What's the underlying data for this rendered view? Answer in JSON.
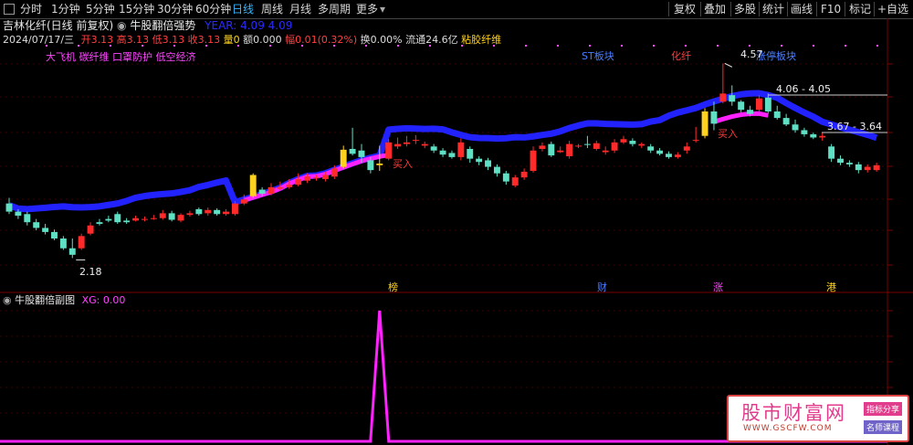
{
  "toolbar": {
    "left_buttons": [
      "分时",
      "1分钟",
      "5分钟",
      "15分钟",
      "30分钟",
      "60分钟",
      "日线",
      "周线",
      "月线",
      "多周期",
      "更多"
    ],
    "active": "日线",
    "right_buttons": [
      "复权",
      "叠加",
      "多股",
      "统计",
      "画线",
      "F10",
      "标记",
      "+自选"
    ]
  },
  "title": {
    "stock": "吉林化纤(日线 前复权)",
    "indicator": "牛股翻倍强势",
    "indicator_values": "YEAR: 4.09  4.09"
  },
  "info": {
    "date": "2024/07/17/三",
    "open": "开3.13",
    "high": "高3.13",
    "low": "低3.13",
    "close": "收3.13",
    "volume": "量0",
    "amount": "额0.000",
    "change": "幅0.01(0.32%)",
    "turnover": "换0.00%",
    "float": "流通24.6亿",
    "concept": "粘胶纤维"
  },
  "concept_tags": "大飞机 碳纤维 口罩防护 低空经济",
  "block_labels": {
    "st": "ST板块",
    "chem": "化纤",
    "limit": "涨停板块"
  },
  "price_labels": {
    "high": "4.57",
    "low": "2.18",
    "range1": "4.06 - 4.05",
    "range2": "3.67 - 3.64"
  },
  "buy_labels": [
    "买入",
    "买入"
  ],
  "bottom_markers": [
    "榜",
    "财",
    "涨",
    "港"
  ],
  "subchart": {
    "title": "牛股翻倍副图",
    "value": "XG: 0.00"
  },
  "watermark": {
    "logo": "股市财富网",
    "url": "WWW.GSCFW.COM",
    "tag1": "指标分享",
    "tag2": "名师课程"
  },
  "colors": {
    "up": "#ff2a2a",
    "down": "#5fe0c4",
    "blue_line": "#2222ff",
    "magenta_line": "#ff22ff",
    "yellow": "#ffd21f",
    "active_tab": "#37b7ff"
  },
  "chart_data": {
    "type": "candlestick",
    "price_min": 2.18,
    "price_max": 4.57,
    "candles": [
      {
        "o": 2.85,
        "c": 2.75,
        "h": 2.92,
        "l": 2.72
      },
      {
        "o": 2.75,
        "c": 2.7,
        "h": 2.78,
        "l": 2.66
      },
      {
        "o": 2.72,
        "c": 2.62,
        "h": 2.75,
        "l": 2.58
      },
      {
        "o": 2.62,
        "c": 2.55,
        "h": 2.66,
        "l": 2.52
      },
      {
        "o": 2.55,
        "c": 2.5,
        "h": 2.6,
        "l": 2.47
      },
      {
        "o": 2.5,
        "c": 2.42,
        "h": 2.53,
        "l": 2.4
      },
      {
        "o": 2.42,
        "c": 2.3,
        "h": 2.45,
        "l": 2.28
      },
      {
        "o": 2.3,
        "c": 2.22,
        "h": 2.42,
        "l": 2.18
      },
      {
        "o": 2.3,
        "c": 2.45,
        "h": 2.48,
        "l": 2.28
      },
      {
        "o": 2.48,
        "c": 2.58,
        "h": 2.62,
        "l": 2.46
      },
      {
        "o": 2.62,
        "c": 2.6,
        "h": 2.66,
        "l": 2.58
      },
      {
        "o": 2.66,
        "c": 2.64,
        "h": 2.7,
        "l": 2.62
      },
      {
        "o": 2.72,
        "c": 2.62,
        "h": 2.75,
        "l": 2.6
      },
      {
        "o": 2.64,
        "c": 2.62,
        "h": 2.67,
        "l": 2.6
      },
      {
        "o": 2.64,
        "c": 2.67,
        "h": 2.7,
        "l": 2.63
      },
      {
        "o": 2.66,
        "c": 2.66,
        "h": 2.69,
        "l": 2.63
      },
      {
        "o": 2.67,
        "c": 2.67,
        "h": 2.71,
        "l": 2.65
      },
      {
        "o": 2.67,
        "c": 2.73,
        "h": 2.77,
        "l": 2.65
      },
      {
        "o": 2.73,
        "c": 2.65,
        "h": 2.76,
        "l": 2.63
      },
      {
        "o": 2.64,
        "c": 2.71,
        "h": 2.73,
        "l": 2.62
      },
      {
        "o": 2.71,
        "c": 2.73,
        "h": 2.76,
        "l": 2.69
      },
      {
        "o": 2.78,
        "c": 2.72,
        "h": 2.8,
        "l": 2.7
      },
      {
        "o": 2.73,
        "c": 2.77,
        "h": 2.8,
        "l": 2.7
      },
      {
        "o": 2.77,
        "c": 2.72,
        "h": 2.79,
        "l": 2.7
      },
      {
        "o": 2.72,
        "c": 2.75,
        "h": 2.78,
        "l": 2.7
      },
      {
        "o": 2.72,
        "c": 2.85,
        "h": 2.88,
        "l": 2.7
      },
      {
        "o": 2.85,
        "c": 2.9,
        "h": 2.96,
        "l": 2.83
      },
      {
        "o": 2.94,
        "c": 3.2,
        "h": 3.22,
        "l": 2.92
      },
      {
        "o": 3.02,
        "c": 2.97,
        "h": 3.05,
        "l": 2.94
      },
      {
        "o": 2.97,
        "c": 3.05,
        "h": 3.1,
        "l": 2.95
      },
      {
        "o": 3.03,
        "c": 3.05,
        "h": 3.12,
        "l": 3.01
      },
      {
        "o": 3.05,
        "c": 3.08,
        "h": 3.15,
        "l": 3.03
      },
      {
        "o": 3.08,
        "c": 3.15,
        "h": 3.22,
        "l": 3.06
      },
      {
        "o": 3.13,
        "c": 3.18,
        "h": 3.22,
        "l": 3.1
      },
      {
        "o": 3.16,
        "c": 3.17,
        "h": 3.2,
        "l": 3.13
      },
      {
        "o": 3.15,
        "c": 3.2,
        "h": 3.24,
        "l": 3.12
      },
      {
        "o": 3.18,
        "c": 3.28,
        "h": 3.32,
        "l": 3.15
      },
      {
        "o": 3.3,
        "c": 3.51,
        "h": 3.56,
        "l": 3.28
      },
      {
        "o": 3.52,
        "c": 3.46,
        "h": 3.78,
        "l": 3.44
      },
      {
        "o": 3.5,
        "c": 3.42,
        "h": 3.58,
        "l": 3.35
      },
      {
        "o": 3.38,
        "c": 3.26,
        "h": 3.42,
        "l": 3.22
      },
      {
        "o": 3.34,
        "c": 3.32,
        "h": 3.56,
        "l": 3.25
      },
      {
        "o": 3.4,
        "c": 3.6,
        "h": 3.64,
        "l": 3.38
      },
      {
        "o": 3.55,
        "c": 3.58,
        "h": 3.66,
        "l": 3.52
      },
      {
        "o": 3.58,
        "c": 3.6,
        "h": 3.68,
        "l": 3.55
      },
      {
        "o": 3.63,
        "c": 3.63,
        "h": 3.69,
        "l": 3.58
      },
      {
        "o": 3.56,
        "c": 3.58,
        "h": 3.61,
        "l": 3.53
      },
      {
        "o": 3.55,
        "c": 3.5,
        "h": 3.58,
        "l": 3.47
      },
      {
        "o": 3.5,
        "c": 3.45,
        "h": 3.53,
        "l": 3.42
      },
      {
        "o": 3.47,
        "c": 3.42,
        "h": 3.5,
        "l": 3.4
      },
      {
        "o": 3.42,
        "c": 3.6,
        "h": 3.65,
        "l": 3.38
      },
      {
        "o": 3.52,
        "c": 3.4,
        "h": 3.55,
        "l": 3.35
      },
      {
        "o": 3.4,
        "c": 3.36,
        "h": 3.43,
        "l": 3.32
      },
      {
        "o": 3.38,
        "c": 3.3,
        "h": 3.41,
        "l": 3.26
      },
      {
        "o": 3.3,
        "c": 3.22,
        "h": 3.33,
        "l": 3.18
      },
      {
        "o": 3.22,
        "c": 3.12,
        "h": 3.25,
        "l": 3.08
      },
      {
        "o": 3.07,
        "c": 3.17,
        "h": 3.2,
        "l": 3.05
      },
      {
        "o": 3.17,
        "c": 3.24,
        "h": 3.28,
        "l": 3.14
      },
      {
        "o": 3.25,
        "c": 3.5,
        "h": 3.55,
        "l": 3.23
      },
      {
        "o": 3.52,
        "c": 3.56,
        "h": 3.6,
        "l": 3.49
      },
      {
        "o": 3.58,
        "c": 3.44,
        "h": 3.61,
        "l": 3.42
      },
      {
        "o": 3.48,
        "c": 3.5,
        "h": 3.55,
        "l": 3.47
      },
      {
        "o": 3.43,
        "c": 3.58,
        "h": 3.62,
        "l": 3.4
      },
      {
        "o": 3.55,
        "c": 3.56,
        "h": 3.58,
        "l": 3.53
      },
      {
        "o": 3.58,
        "c": 3.57,
        "h": 3.68,
        "l": 3.53
      },
      {
        "o": 3.52,
        "c": 3.59,
        "h": 3.62,
        "l": 3.5
      },
      {
        "o": 3.48,
        "c": 3.5,
        "h": 3.55,
        "l": 3.45
      },
      {
        "o": 3.5,
        "c": 3.6,
        "h": 3.64,
        "l": 3.47
      },
      {
        "o": 3.6,
        "c": 3.64,
        "h": 3.68,
        "l": 3.58
      },
      {
        "o": 3.62,
        "c": 3.58,
        "h": 3.65,
        "l": 3.55
      },
      {
        "o": 3.56,
        "c": 3.58,
        "h": 3.6,
        "l": 3.53
      },
      {
        "o": 3.55,
        "c": 3.5,
        "h": 3.58,
        "l": 3.47
      },
      {
        "o": 3.5,
        "c": 3.46,
        "h": 3.53,
        "l": 3.44
      },
      {
        "o": 3.46,
        "c": 3.42,
        "h": 3.49,
        "l": 3.4
      },
      {
        "o": 3.42,
        "c": 3.45,
        "h": 3.48,
        "l": 3.4
      },
      {
        "o": 3.5,
        "c": 3.55,
        "h": 3.6,
        "l": 3.46
      },
      {
        "o": 3.62,
        "c": 3.63,
        "h": 3.79,
        "l": 3.6
      },
      {
        "o": 3.68,
        "c": 3.98,
        "h": 4.02,
        "l": 3.65
      },
      {
        "o": 3.98,
        "c": 3.83,
        "h": 4.1,
        "l": 3.75
      },
      {
        "o": 4.1,
        "c": 4.2,
        "h": 4.57,
        "l": 4.08
      },
      {
        "o": 4.18,
        "c": 4.1,
        "h": 4.3,
        "l": 4.05
      },
      {
        "o": 4.1,
        "c": 4.0,
        "h": 4.12,
        "l": 3.97
      },
      {
        "o": 4.0,
        "c": 3.95,
        "h": 4.05,
        "l": 3.92
      },
      {
        "o": 4.0,
        "c": 4.14,
        "h": 4.18,
        "l": 3.97
      },
      {
        "o": 4.15,
        "c": 3.98,
        "h": 4.2,
        "l": 3.96
      },
      {
        "o": 3.98,
        "c": 3.9,
        "h": 4.05,
        "l": 3.88
      },
      {
        "o": 3.9,
        "c": 3.82,
        "h": 3.95,
        "l": 3.8
      },
      {
        "o": 3.82,
        "c": 3.75,
        "h": 3.88,
        "l": 3.72
      },
      {
        "o": 3.75,
        "c": 3.7,
        "h": 3.78,
        "l": 3.67
      },
      {
        "o": 3.7,
        "c": 3.66,
        "h": 3.72,
        "l": 3.64
      },
      {
        "o": 3.66,
        "c": 3.68,
        "h": 3.72,
        "l": 3.62
      },
      {
        "o": 3.55,
        "c": 3.4,
        "h": 3.58,
        "l": 3.36
      },
      {
        "o": 3.4,
        "c": 3.35,
        "h": 3.44,
        "l": 3.32
      },
      {
        "o": 3.35,
        "c": 3.33,
        "h": 3.38,
        "l": 3.3
      },
      {
        "o": 3.33,
        "c": 3.26,
        "h": 3.36,
        "l": 3.22
      },
      {
        "o": 3.26,
        "c": 3.3,
        "h": 3.33,
        "l": 3.23
      },
      {
        "o": 3.26,
        "c": 3.32,
        "h": 3.35,
        "l": 3.24
      }
    ],
    "markers": [
      [
        3.12,
        3.42,
        3.52,
        3.32,
        3.18
      ],
      [
        4.57,
        2.18
      ]
    ]
  }
}
